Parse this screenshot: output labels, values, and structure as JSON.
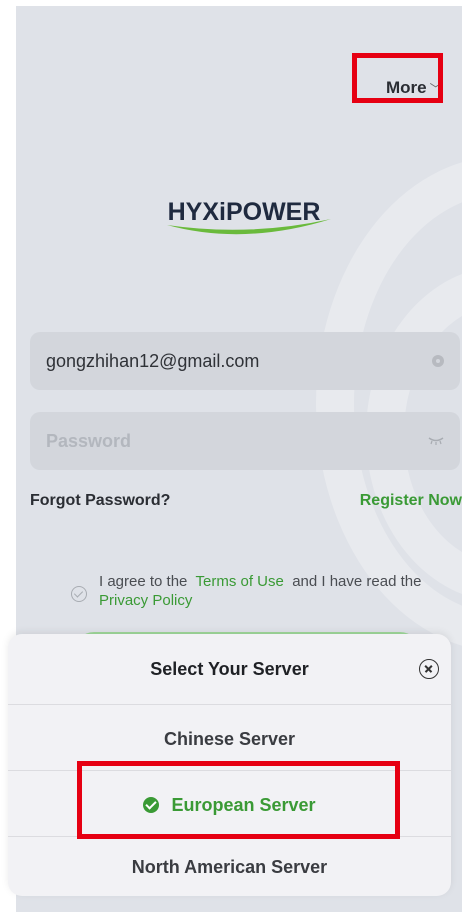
{
  "header": {
    "more_label": "More"
  },
  "logo": {
    "text": "HYXiPOWER"
  },
  "login": {
    "email_value": "gongzhihan12@gmail.com",
    "password_placeholder": "Password",
    "forgot_label": "Forgot Password?",
    "register_label": "Register Now",
    "agree_prefix": "I agree to the",
    "terms_label": "Terms of Use",
    "agree_middle": "and I have read the",
    "privacy_label": "Privacy Policy"
  },
  "server_sheet": {
    "title": "Select Your Server",
    "options": [
      {
        "label": "Chinese Server",
        "selected": false
      },
      {
        "label": "European Server",
        "selected": true
      },
      {
        "label": "North American Server",
        "selected": false
      }
    ]
  },
  "colors": {
    "accent": "#3a9a35",
    "highlight": "#e60012"
  },
  "icons": [
    "chevron-down-icon",
    "clear-icon",
    "eye-closed-icon",
    "checkbox-icon",
    "close-icon",
    "check-circle-icon"
  ]
}
